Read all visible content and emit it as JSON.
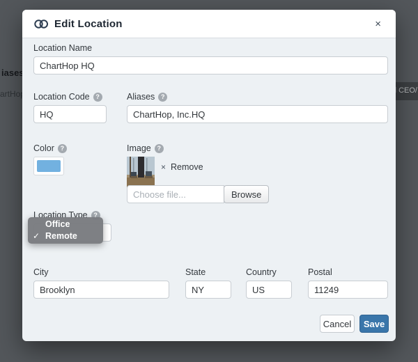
{
  "backdrop": {
    "left_fragment_1": "iases",
    "left_fragment_2": "artHop",
    "right_fragment": "d CEO/"
  },
  "icons": {
    "help": "?",
    "close": "×",
    "remove_x": "×",
    "check": "✓"
  },
  "modal": {
    "title": "Edit Location",
    "fields": {
      "location_name": {
        "label": "Location Name",
        "value": "ChartHop HQ"
      },
      "location_code": {
        "label": "Location Code",
        "value": "HQ"
      },
      "aliases": {
        "label": "Aliases",
        "value": "ChartHop, Inc.HQ"
      },
      "color": {
        "label": "Color",
        "swatch_color": "#72b1e0"
      },
      "image": {
        "label": "Image",
        "remove_label": "Remove",
        "file_placeholder": "Choose file...",
        "browse_label": "Browse"
      },
      "location_type": {
        "label": "Location Type"
      },
      "city": {
        "label": "City",
        "value": "Brooklyn"
      },
      "state": {
        "label": "State",
        "value": "NY"
      },
      "country": {
        "label": "Country",
        "value": "US"
      },
      "postal": {
        "label": "Postal",
        "value": "11249"
      }
    },
    "dropdown": {
      "options": [
        {
          "label": "Office",
          "selected": false
        },
        {
          "label": "Remote",
          "selected": true
        }
      ]
    },
    "footer": {
      "cancel_label": "Cancel",
      "save_label": "Save"
    },
    "colors": {
      "save_bg": "#3a76aa",
      "accent_blue": "#72b1e0",
      "backdrop": "#53575b",
      "modal_bg": "#edf1f4"
    }
  }
}
